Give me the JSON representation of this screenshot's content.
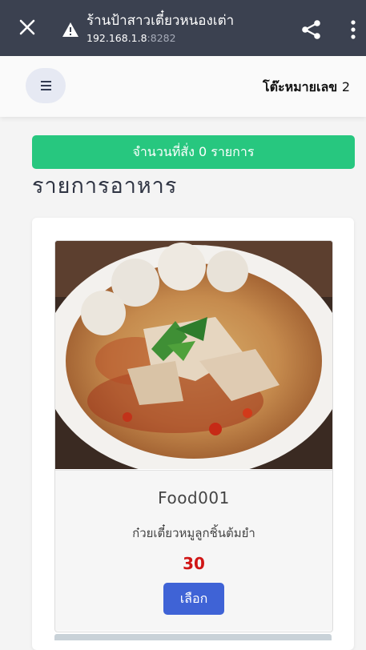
{
  "browser": {
    "title": "ร้านป้าสาวเตี๋ยวหนองเต่า",
    "host": "192.168.1.8",
    "port": ":8282",
    "close_icon": "close-icon",
    "warning_icon": "warning-icon",
    "share_icon": "share-icon",
    "more_icon": "more-vert-icon"
  },
  "header": {
    "menu_icon": "hamburger-menu-icon",
    "table_label": "โต๊ะหมายเลข",
    "table_number": "2"
  },
  "order": {
    "banner_text": "จำนวนที่สั่ง 0 รายการ"
  },
  "section": {
    "title": "รายการอาหาร"
  },
  "menu_items": [
    {
      "code": "Food001",
      "name": "ก๋วยเตี๋ยวหมูลูกชิ้นต้มยำ",
      "price": "30",
      "select_label": "เลือก"
    }
  ],
  "colors": {
    "browser_bar": "#3b4150",
    "banner": "#27c77f",
    "price": "#d01616",
    "button": "#3f63d6"
  }
}
